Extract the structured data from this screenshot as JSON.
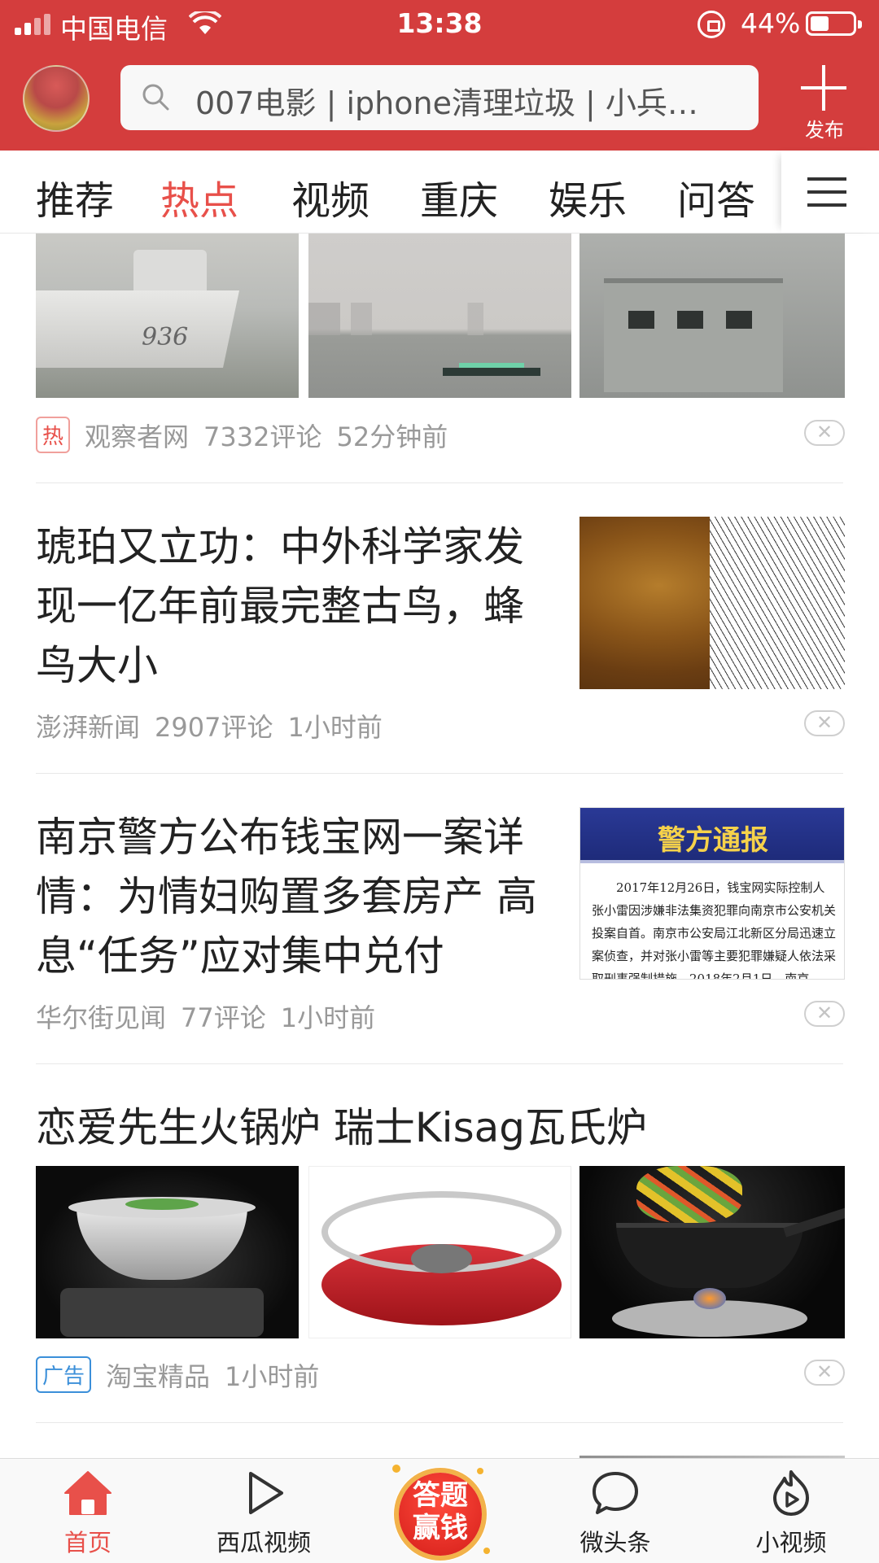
{
  "status_bar": {
    "carrier": "中国电信",
    "time": "13:38",
    "battery_percent": "44%",
    "battery_level": 0.44,
    "icons": [
      "signal-icon",
      "wifi-icon",
      "orientation-lock-icon",
      "battery-icon"
    ]
  },
  "header": {
    "search_placeholder": "007电影 | iphone清理垃圾 | 小兵…",
    "publish_label": "发布",
    "accent_color": "#d43d3d"
  },
  "tabs": {
    "items": [
      "推荐",
      "热点",
      "视频",
      "重庆",
      "娱乐",
      "问答"
    ],
    "active": "热点",
    "active_color": "#e8504a"
  },
  "feed": {
    "items": [
      {
        "badge": "热",
        "source": "观察者网",
        "comments": "7332评论",
        "time": "52分钟前"
      },
      {
        "title": "琥珀又立功：中外科学家发现一亿年前最完整古鸟，蜂鸟大小",
        "source": "澎湃新闻",
        "comments": "2907评论",
        "time": "1小时前"
      },
      {
        "title": "南京警方公布钱宝网一案详情：为情妇购置多套房产 高息“任务”应对集中兑付",
        "source": "华尔街见闻",
        "comments": "77评论",
        "time": "1小时前",
        "image_heading": "警方通报",
        "image_text": "2017年12月26日，钱宝网实际控制人张小雷因涉嫌非法集资犯罪向南京市公安机关投案自首。南京市公安局江北新区分局迅速立案侦查，并对张小雷等主要犯罪嫌疑人依法采取刑事强制措施。2018年2月1日，南京"
      },
      {
        "title": "恋爱先生火锅炉 瑞士Kisag瓦氏炉",
        "badge": "广告",
        "source": "淘宝精品",
        "time": "1小时前"
      }
    ],
    "ship_hull_number": "936",
    "close_glyph": "✕"
  },
  "bottom_nav": {
    "items": [
      {
        "label": "首页",
        "icon": "home-icon"
      },
      {
        "label": "西瓜视频",
        "icon": "play-icon"
      },
      {
        "label": "答题赢钱",
        "icon": "quiz-icon"
      },
      {
        "label": "微头条",
        "icon": "chat-bubble-icon"
      },
      {
        "label": "小视频",
        "icon": "flame-play-icon"
      }
    ],
    "active": "首页",
    "quiz_line1": "答题",
    "quiz_line2": "赢钱"
  }
}
